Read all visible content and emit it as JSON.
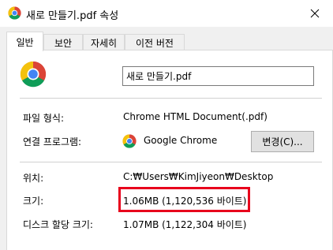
{
  "window": {
    "title": "새로 만들기.pdf 속성",
    "close_symbol": "✕"
  },
  "tabs": [
    {
      "label": "일반",
      "active": true
    },
    {
      "label": "보안",
      "active": false
    },
    {
      "label": "자세히",
      "active": false
    },
    {
      "label": "이전 버전",
      "active": false
    }
  ],
  "general": {
    "file_name": "새로 만들기.pdf",
    "file_type_label": "파일 형식:",
    "file_type_value": "Chrome HTML Document(.pdf)",
    "opens_with_label": "연결 프로그램:",
    "opens_with_value": "Google Chrome",
    "change_button": "변경(C)...",
    "location_label": "위치:",
    "location_value": "C:₩Users₩KimJiyeon₩Desktop",
    "size_label": "크기:",
    "size_value": "1.06MB (1,120,536 바이트)",
    "size_on_disk_label": "디스크 할당 크기:",
    "size_on_disk_value": "1.07MB (1,122,304 바이트)"
  },
  "colors": {
    "highlight": "#e8001c",
    "chrome_red": "#db4437",
    "chrome_yellow": "#f4c20d",
    "chrome_green": "#0f9d58",
    "chrome_blue": "#4285f4"
  },
  "icons": {
    "title": "chrome-icon",
    "file": "chrome-icon",
    "app": "chrome-icon",
    "close": "close-icon"
  }
}
